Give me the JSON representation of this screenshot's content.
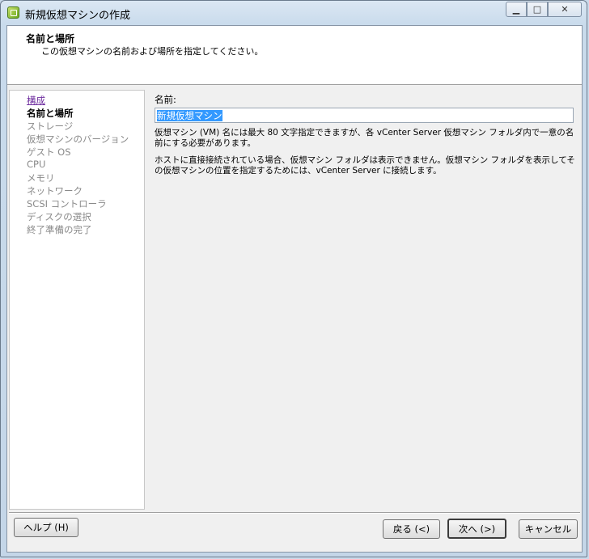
{
  "window": {
    "title": "新規仮想マシンの作成",
    "caption_buttons": {
      "minimize": "▁",
      "maximize": "□",
      "close": "✕"
    }
  },
  "header": {
    "title": "名前と場所",
    "subtitle": "この仮想マシンの名前および場所を指定してください。"
  },
  "nav": {
    "items": [
      {
        "label": "構成",
        "state": "link"
      },
      {
        "label": "名前と場所",
        "state": "current"
      },
      {
        "label": "ストレージ",
        "state": "disabled"
      },
      {
        "label": "仮想マシンのバージョン",
        "state": "disabled"
      },
      {
        "label": "ゲスト OS",
        "state": "disabled"
      },
      {
        "label": "CPU",
        "state": "disabled"
      },
      {
        "label": "メモリ",
        "state": "disabled"
      },
      {
        "label": "ネットワーク",
        "state": "disabled"
      },
      {
        "label": "SCSI コントローラ",
        "state": "disabled"
      },
      {
        "label": "ディスクの選択",
        "state": "disabled"
      },
      {
        "label": "終了準備の完了",
        "state": "disabled"
      }
    ]
  },
  "form": {
    "name_label": "名前:",
    "name_value": "新規仮想マシン",
    "description_line1": "仮想マシン (VM) 名には最大 80 文字指定できますが、各 vCenter Server 仮想マシン フォルダ内で一意の名前にする必要があります。",
    "description_line2": "ホストに直接接続されている場合、仮想マシン フォルダは表示できません。仮想マシン フォルダを表示してその仮想マシンの位置を指定するためには、vCenter Server に接続します。"
  },
  "buttons": {
    "help": "ヘルプ (H)",
    "back": "戻る (<)",
    "next": "次へ (>)",
    "cancel": "キャンセル"
  },
  "colors": {
    "selection": "#3399ff",
    "link": "#7030a0",
    "disabled_text": "#8a8a8a"
  }
}
